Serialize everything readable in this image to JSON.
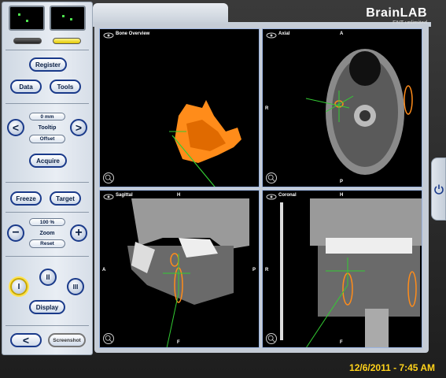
{
  "header": {
    "brand": "BrainLAB",
    "subtitle": "ENT unlimited"
  },
  "controls": {
    "register": "Register",
    "data": "Data",
    "tools": "Tools",
    "tooltip_value": "0 mm",
    "tooltip_label": "Tooltip",
    "offset": "Offset",
    "acquire": "Acquire",
    "freeze": "Freeze",
    "target": "Target",
    "zoom_value": "100 %",
    "zoom_label": "Zoom",
    "reset": "Reset",
    "layout_1": "I",
    "layout_2": "II",
    "layout_3": "III",
    "display": "Display",
    "back": "<",
    "screenshot": "Screenshot",
    "minus": "−",
    "plus": "+",
    "prev": "<",
    "next": ">"
  },
  "viewports": {
    "bone": {
      "title": "Bone Overview"
    },
    "axial": {
      "title": "Axial",
      "top": "A",
      "left": "R",
      "bottom": "P"
    },
    "sagittal": {
      "title": "Sagittal",
      "top": "H",
      "left": "A",
      "right": "P",
      "bottom": "F"
    },
    "coronal": {
      "title": "Coronal",
      "top": "H",
      "left": "R",
      "bottom": "F"
    }
  },
  "status": {
    "datetime": "12/6/2011 - 7:45 AM"
  },
  "colors": {
    "accent": "#1a3a8a",
    "datetime": "#ffd21a",
    "bone": "#ff8c1a"
  },
  "icons": [
    "eye-icon",
    "zoom-icon",
    "power-icon"
  ]
}
